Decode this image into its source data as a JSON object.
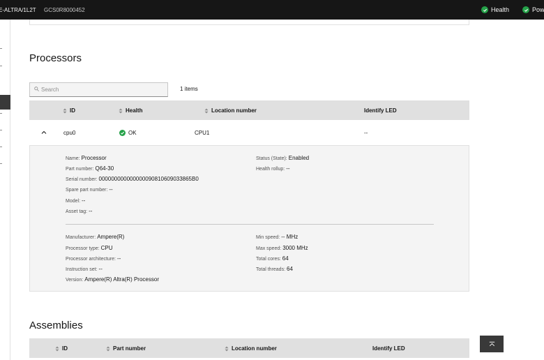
{
  "header": {
    "system_name": "E-ALTRA/1L2T",
    "serial": "GCS0R8000452",
    "health_label": "Health",
    "power_label": "Pow"
  },
  "processors": {
    "title": "Processors",
    "search_placeholder": "Search",
    "items_count": "1 items",
    "columns": [
      "ID",
      "Health",
      "Location number",
      "Identify LED"
    ],
    "row": {
      "id": "cpu0",
      "health": "OK",
      "location": "CPU1",
      "identify_led": "--"
    },
    "details": {
      "name_label": "Name:",
      "name": "Processor",
      "part_number_label": "Part number:",
      "part_number": "Q64-30",
      "serial_number_label": "Serial number:",
      "serial_number": "000000000000000090810609033865B0",
      "spare_part_label": "Spare part number:",
      "spare_part": "--",
      "model_label": "Model:",
      "model": "--",
      "asset_tag_label": "Asset tag:",
      "asset_tag": "--",
      "status_label": "Status (State):",
      "status": "Enabled",
      "health_rollup_label": "Health rollup:",
      "health_rollup": "--",
      "manufacturer_label": "Manufacturer:",
      "manufacturer": "Ampere(R)",
      "processor_type_label": "Processor type:",
      "processor_type": "CPU",
      "architecture_label": "Processor architecture:",
      "architecture": "--",
      "instruction_set_label": "Instruction set:",
      "instruction_set": "--",
      "version_label": "Version:",
      "version": "Ampere(R) Altra(R) Processor",
      "min_speed_label": "Min speed:",
      "min_speed": "-- MHz",
      "max_speed_label": "Max speed:",
      "max_speed": "3000 MHz",
      "total_cores_label": "Total cores:",
      "total_cores": "64",
      "total_threads_label": "Total threads:",
      "total_threads": "64"
    }
  },
  "assemblies": {
    "title": "Assemblies",
    "columns": [
      "ID",
      "Part number",
      "Location number",
      "Identify LED"
    ]
  },
  "colors": {
    "ok_green": "#24a148",
    "topbar": "#161616",
    "table_header": "#e0e0e0",
    "expanded_bg": "#f4f4f4"
  },
  "icons": [
    "checkmark-icon",
    "search-icon",
    "sort-icon",
    "chevron-up-icon",
    "back-to-top-icon"
  ]
}
